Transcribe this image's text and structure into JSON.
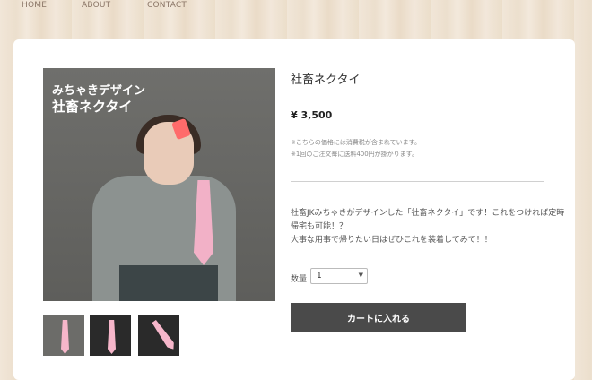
{
  "nav": {
    "items": [
      {
        "label": "HOME"
      },
      {
        "label": "ABOUT"
      },
      {
        "label": "CONTACT"
      }
    ]
  },
  "product": {
    "title": "社畜ネクタイ",
    "price": "¥ 3,500",
    "notes": [
      "※こちらの価格には消費税が含まれています。",
      "※1回のご注文毎に送料400円が掛かります。"
    ],
    "description": [
      "社畜JKみちゃきがデザインした「社畜ネクタイ」です！これをつければ定時",
      "帰宅も可能！？",
      "大事な用事で帰りたい日はぜひこれを装着してみて！！"
    ],
    "image_caption": {
      "line1": "みちゃきデザイン",
      "line2": "社畜ネクタイ"
    }
  },
  "quantity": {
    "label": "数量",
    "value": "1"
  },
  "cart": {
    "button_label": "カートに入れる"
  },
  "colors": {
    "button_bg": "#4a4a4a",
    "accent_pink": "#ff4f8b"
  }
}
